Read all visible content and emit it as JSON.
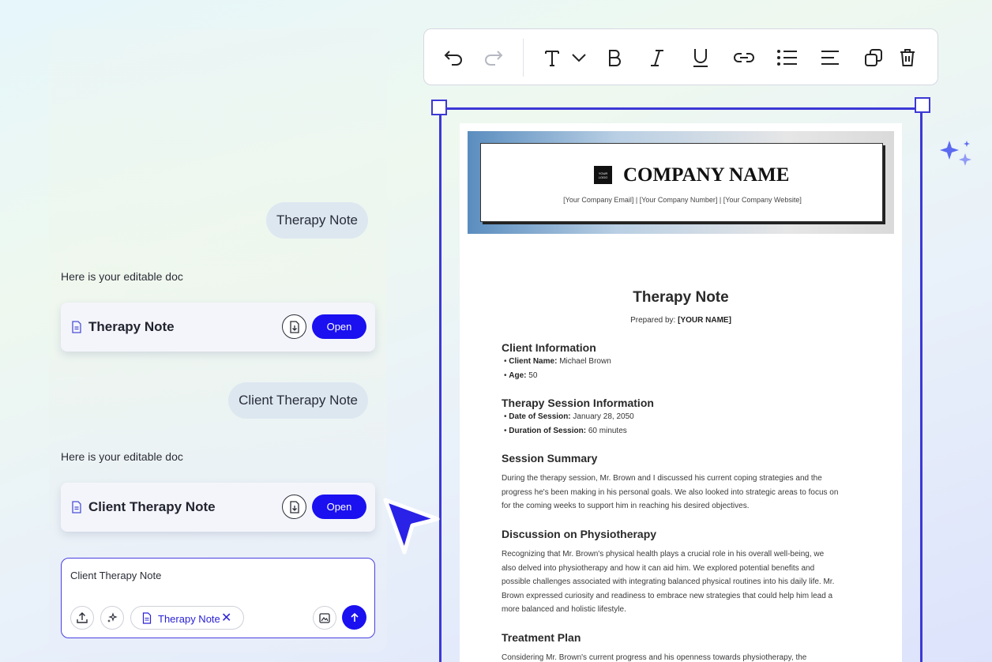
{
  "colors": {
    "accent": "#1a10f0",
    "frame": "#3c38d6",
    "bubble": "#dce7f0"
  },
  "chat": {
    "messages": [
      {
        "role": "user",
        "text": "Therapy Note"
      },
      {
        "role": "assistant",
        "text": "Here is your editable doc",
        "doc_title": "Therapy Note",
        "open_label": "Open",
        "icon": "document-icon"
      },
      {
        "role": "user",
        "text": "Client Therapy Note"
      },
      {
        "role": "assistant",
        "text": "Here is your editable doc",
        "doc_title": "Client Therapy Note",
        "open_label": "Open",
        "icon": "document-icon"
      }
    ],
    "composer": {
      "value": "Client Therapy Note",
      "chip_label": "Therapy Note",
      "chip_close": "✕"
    }
  },
  "toolbar": {
    "buttons": [
      "undo-icon",
      "redo-icon",
      "text-style-icon",
      "chevron-down-icon",
      "bold-icon",
      "italic-icon",
      "underline-icon",
      "link-icon",
      "bullet-list-icon",
      "align-left-icon",
      "duplicate-icon",
      "delete-icon"
    ]
  },
  "document": {
    "logo_text": "YOUR LOGO",
    "company_name": "COMPANY NAME",
    "company_contacts": "[Your Company Email] | [Your Company Number] | [Your Company Website]",
    "title": "Therapy Note",
    "prepared_label": "Prepared by:",
    "prepared_value": "[YOUR NAME]",
    "client_info": {
      "heading": "Client Information",
      "name_label": "Client Name:",
      "name_value": "Michael Brown",
      "age_label": "Age:",
      "age_value": "50"
    },
    "session_info": {
      "heading": "Therapy Session Information",
      "date_label": "Date of Session:",
      "date_value": "January 28, 2050",
      "duration_label": "Duration of Session:",
      "duration_value": "60 minutes"
    },
    "summary": {
      "heading": "Session Summary",
      "lines": [
        "During the therapy session, Mr. Brown and I discussed his current coping strategies and the",
        "progress he's been making in his personal goals. We also looked into strategic areas to focus on",
        "for the coming weeks to support him in reaching his desired objectives."
      ]
    },
    "physio": {
      "heading": "Discussion on Physiotherapy",
      "lines": [
        "Recognizing that Mr. Brown's physical health plays a crucial role in his overall well-being, we",
        "also delved into physiotherapy and how it can aid him. We explored potential benefits and",
        "possible challenges associated with integrating balanced physical routines into his daily life. Mr.",
        "Brown expressed curiosity and readiness to embrace new strategies that could help him lead a",
        "more balanced and holistic lifestyle."
      ]
    },
    "treatment": {
      "heading": "Treatment Plan",
      "lines": [
        "Considering Mr. Brown's current progress and his openness towards physiotherapy, the"
      ]
    }
  }
}
